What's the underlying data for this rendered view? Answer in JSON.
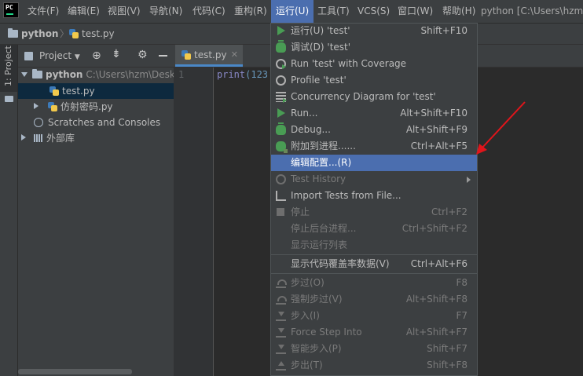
{
  "menubar": {
    "items": [
      "文件(F)",
      "编辑(E)",
      "视图(V)",
      "导航(N)",
      "代码(C)",
      "重构(R)",
      "运行(U)",
      "工具(T)",
      "VCS(S)",
      "窗口(W)",
      "帮助(H)"
    ],
    "window_title": "python [C:\\Users\\hzm"
  },
  "navbar": {
    "project": "python",
    "file": "test.py"
  },
  "tool_stripe": {
    "project_tab": "1: Project"
  },
  "project_panel": {
    "title": "Project",
    "root": {
      "name": "python",
      "path": "C:\\Users\\hzm\\Desk"
    },
    "files": [
      "test.py",
      "仿射密码.py"
    ],
    "scratches": "Scratches and Consoles",
    "external": "外部库"
  },
  "editor": {
    "tab": "test.py",
    "line_number": "1",
    "code_keyword": "print",
    "code_rest": "(123"
  },
  "run_menu": {
    "items": [
      {
        "label": "运行(U) 'test'",
        "shortcut": "Shift+F10",
        "icon": "run-icon",
        "state": "enabled"
      },
      {
        "label": "调试(D) 'test'",
        "shortcut": "",
        "icon": "debug-icon",
        "state": "enabled"
      },
      {
        "label": "Run 'test' with Coverage",
        "shortcut": "",
        "icon": "coverage-icon",
        "state": "enabled"
      },
      {
        "label": "Profile 'test'",
        "shortcut": "",
        "icon": "profile-icon",
        "state": "enabled"
      },
      {
        "label": "Concurrency Diagram for 'test'",
        "shortcut": "",
        "icon": "concurrency-icon",
        "state": "enabled"
      },
      {
        "label": "Run...",
        "shortcut": "Alt+Shift+F10",
        "icon": "run-icon",
        "state": "enabled"
      },
      {
        "label": "Debug...",
        "shortcut": "Alt+Shift+F9",
        "icon": "debug-icon",
        "state": "enabled"
      },
      {
        "label": "附加到进程......",
        "shortcut": "Ctrl+Alt+F5",
        "icon": "attach-icon",
        "state": "enabled"
      },
      {
        "label": "编辑配置...(R)",
        "shortcut": "",
        "icon": "",
        "state": "selected"
      },
      {
        "label": "Test History",
        "shortcut": "",
        "icon": "history-icon",
        "state": "disabled",
        "submenu": true
      },
      {
        "label": "Import Tests from File...",
        "shortcut": "",
        "icon": "import-icon",
        "state": "enabled"
      },
      {
        "label": "停止",
        "shortcut": "Ctrl+F2",
        "icon": "stop-icon",
        "state": "disabled"
      },
      {
        "label": "停止后台进程...",
        "shortcut": "Ctrl+Shift+F2",
        "icon": "",
        "state": "disabled"
      },
      {
        "label": "显示运行列表",
        "shortcut": "",
        "icon": "",
        "state": "disabled"
      },
      {
        "label": "显示代码覆盖率数据(V)",
        "shortcut": "Ctrl+Alt+F6",
        "icon": "",
        "state": "enabled"
      },
      {
        "label": "步过(O)",
        "shortcut": "F8",
        "icon": "step-over-icon",
        "state": "disabled"
      },
      {
        "label": "强制步过(V)",
        "shortcut": "Alt+Shift+F8",
        "icon": "force-step-over-icon",
        "state": "disabled"
      },
      {
        "label": "步入(I)",
        "shortcut": "F7",
        "icon": "step-into-icon",
        "state": "disabled"
      },
      {
        "label": "Force Step Into",
        "shortcut": "Alt+Shift+F7",
        "icon": "force-step-into-icon",
        "state": "disabled"
      },
      {
        "label": "智能步入(P)",
        "shortcut": "Shift+F7",
        "icon": "smart-step-into-icon",
        "state": "disabled"
      },
      {
        "label": "步出(T)",
        "shortcut": "Shift+F8",
        "icon": "step-out-icon",
        "state": "disabled"
      }
    ]
  },
  "colors": {
    "menu_selection": "#4b6eaf",
    "annotation_arrow": "#e0151b"
  }
}
